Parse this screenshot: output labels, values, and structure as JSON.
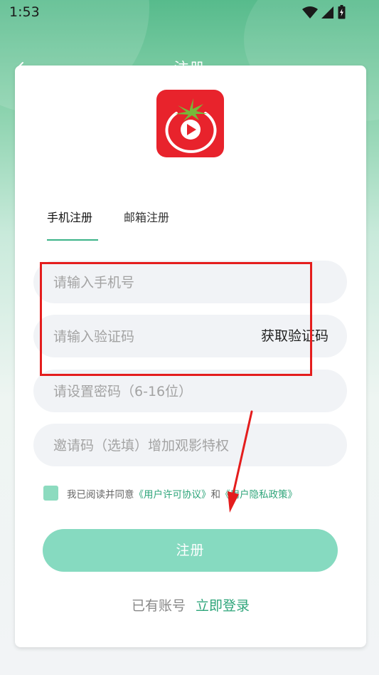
{
  "status_bar": {
    "time": "1:53"
  },
  "header": {
    "title": "注册"
  },
  "tabs": [
    {
      "label": "手机注册",
      "active": true
    },
    {
      "label": "邮箱注册",
      "active": false
    }
  ],
  "form": {
    "phone_placeholder": "请输入手机号",
    "code_placeholder": "请输入验证码",
    "get_code_label": "获取验证码",
    "password_placeholder": "请设置密码（6-16位）",
    "invite_placeholder": "邀请码（选填）增加观影特权"
  },
  "agreement": {
    "prefix": "我已阅读并同意",
    "user_agreement": "《用户许可协议》",
    "conjunction": "和",
    "privacy_policy": "《用户隐私政策》"
  },
  "register_button": "注册",
  "login": {
    "has_account": "已有账号",
    "login_now": "立即登录"
  },
  "colors": {
    "accent": "#2ea57a",
    "button": "#86dac0",
    "logo_red": "#e8232c",
    "annotation_red": "#e41d1d"
  },
  "icons": [
    "wifi-icon",
    "signal-icon",
    "battery-icon",
    "back-arrow-icon",
    "tomato-play-logo",
    "checkbox-icon"
  ]
}
